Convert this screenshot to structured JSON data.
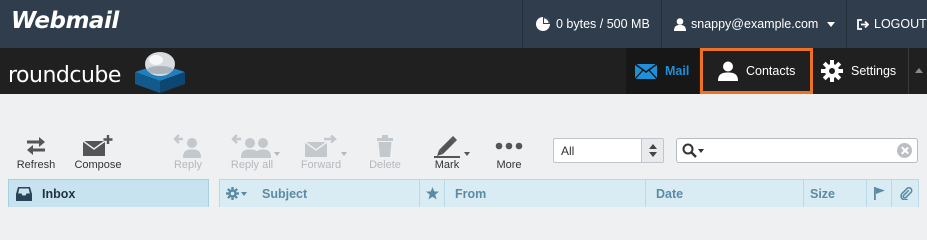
{
  "topbar": {
    "brand": "Webmail",
    "quota": "0 bytes / 500 MB",
    "user": "snappy@example.com",
    "logout": "LOGOUT"
  },
  "header": {
    "logo_text": "roundcube",
    "tasks": [
      {
        "label": "Mail",
        "icon": "mail-icon",
        "active": true
      },
      {
        "label": "Contacts",
        "icon": "person-icon",
        "highlighted": true
      },
      {
        "label": "Settings",
        "icon": "gear-icon"
      }
    ]
  },
  "toolbar": {
    "buttons": [
      {
        "label": "Refresh",
        "icon": "refresh-icon",
        "enabled": true
      },
      {
        "label": "Compose",
        "icon": "compose-icon",
        "enabled": true
      },
      {
        "label": "Reply",
        "icon": "reply-icon",
        "enabled": false
      },
      {
        "label": "Reply all",
        "icon": "reply-all-icon",
        "enabled": false
      },
      {
        "label": "Forward",
        "icon": "forward-icon",
        "enabled": false
      },
      {
        "label": "Delete",
        "icon": "trash-icon",
        "enabled": false
      },
      {
        "label": "Mark",
        "icon": "mark-icon",
        "enabled": true
      },
      {
        "label": "More",
        "icon": "more-icon",
        "enabled": true
      }
    ],
    "filter_value": "All",
    "search_placeholder": ""
  },
  "folders": {
    "current": "Inbox"
  },
  "message_list": {
    "columns": [
      "Subject",
      "From",
      "Date",
      "Size"
    ]
  },
  "colors": {
    "topbar_bg": "#2f3d4c",
    "header_bg": "#202020",
    "accent_blue": "#1f8fd8",
    "highlight_orange": "#ed7223",
    "list_header_bg": "#d9ecf4"
  }
}
